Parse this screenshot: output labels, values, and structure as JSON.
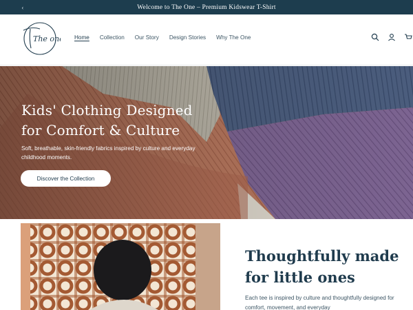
{
  "announcement": {
    "text": "Welcome to The One – Premium Kidswear T-Shirt"
  },
  "logo": {
    "text": "The one"
  },
  "nav": {
    "items": [
      {
        "label": "Home",
        "active": true
      },
      {
        "label": "Collection",
        "active": false
      },
      {
        "label": "Our Story",
        "active": false
      },
      {
        "label": "Design Stories",
        "active": false
      },
      {
        "label": "Why The One",
        "active": false
      }
    ]
  },
  "header_icons": [
    "search-icon",
    "account-icon",
    "cart-icon"
  ],
  "hero": {
    "title_line1": "Kids' Clothing Designed",
    "title_line2": "for Comfort & Culture",
    "subtitle": "Soft, breathable, skin-friendly fabrics inspired by culture and everyday childhood moments.",
    "button": "Discover the Collection"
  },
  "section": {
    "title_line1": "Thoughtfully made",
    "title_line2": "for little ones",
    "body": "Each tee is inspired by culture and thoughtfully designed for comfort, movement, and everyday"
  },
  "colors": {
    "announcement_bg": "#1d3d4e",
    "primary_text": "#1f3b4d"
  }
}
